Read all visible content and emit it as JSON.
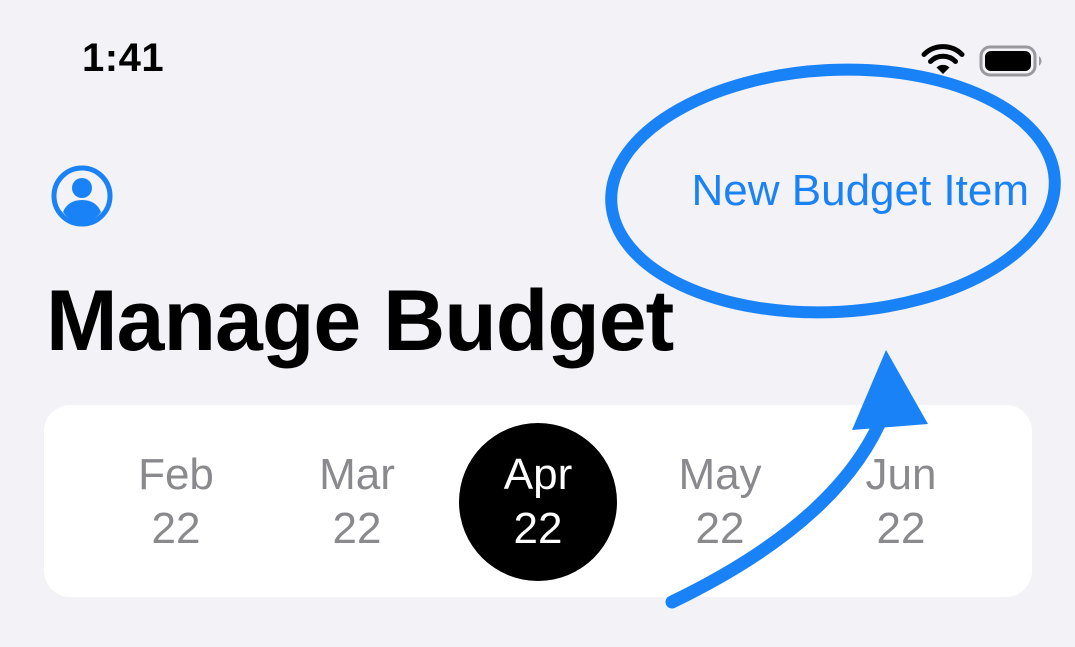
{
  "status_bar": {
    "time": "1:41",
    "icons": [
      "wifi-icon",
      "battery-icon"
    ]
  },
  "nav": {
    "profile_icon": "person-circle-icon",
    "action_label": "New Budget Item"
  },
  "page": {
    "title": "Manage Budget"
  },
  "months": [
    {
      "month": "Feb",
      "year": "22",
      "selected": false
    },
    {
      "month": "Mar",
      "year": "22",
      "selected": false
    },
    {
      "month": "Apr",
      "year": "22",
      "selected": true
    },
    {
      "month": "May",
      "year": "22",
      "selected": false
    },
    {
      "month": "Jun",
      "year": "22",
      "selected": false
    }
  ],
  "annotation": {
    "type": "circle-and-arrow",
    "target": "New Budget Item",
    "color": "#1a82f7"
  },
  "colors": {
    "accent": "#1a82f7",
    "background": "#f2f2f7",
    "selected_month_bg": "#000000",
    "unselected_month_text": "#8a8a8e"
  }
}
